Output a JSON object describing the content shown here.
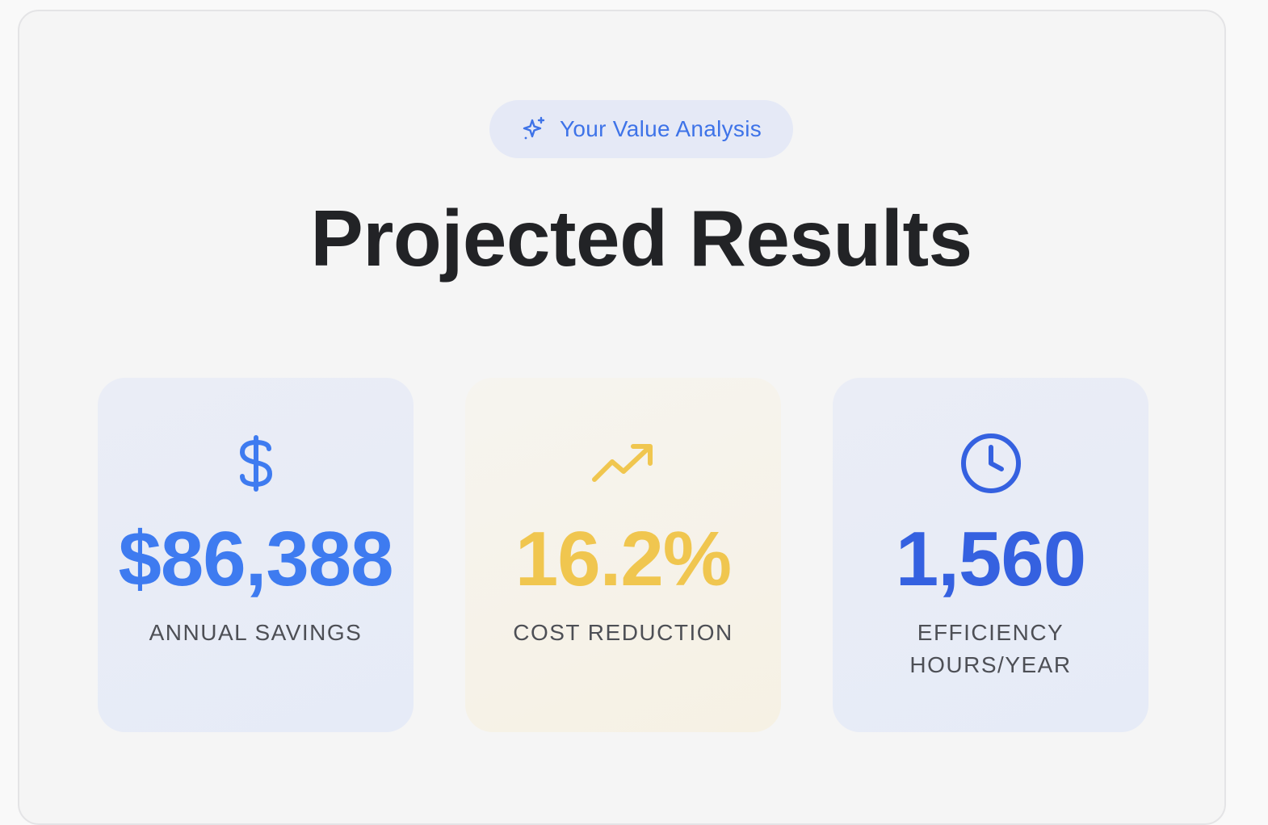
{
  "header": {
    "badge_icon": "sparkles-icon",
    "badge_label": "Your Value Analysis",
    "title": "Projected Results"
  },
  "metrics": [
    {
      "icon": "dollar-icon",
      "value": "$86,388",
      "label": "ANNUAL SAVINGS",
      "color": "#3e7bf0"
    },
    {
      "icon": "trending-up-icon",
      "value": "16.2%",
      "label": "COST REDUCTION",
      "color": "#f0c64f"
    },
    {
      "icon": "clock-icon",
      "value": "1,560",
      "label": "EFFICIENCY HOURS/YEAR",
      "color": "#3561e0"
    }
  ],
  "colors": {
    "accent": "#3e73e8",
    "badge_bg": "#e5e9f6",
    "title": "#222326",
    "label": "#4d4f55"
  }
}
